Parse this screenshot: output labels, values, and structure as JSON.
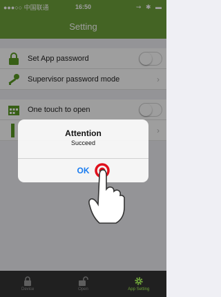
{
  "status_bar": {
    "carrier": "●●●○○ 中国联通",
    "time": "16:50",
    "right_icons": "⇝ ✱ ▬"
  },
  "nav": {
    "title": "Setting"
  },
  "rows": [
    {
      "label": "Set App password",
      "icon": "lock-icon",
      "accessory": "toggle"
    },
    {
      "label": "Supervisor password mode",
      "icon": "key-icon",
      "accessory": "chevron"
    },
    {
      "label": "One touch to open",
      "icon": "calendar-icon",
      "accessory": "toggle"
    },
    {
      "label": "",
      "icon": "tool-icon",
      "accessory": "chevron"
    }
  ],
  "alert": {
    "title": "Attention",
    "message": "Succeed",
    "ok_label": "OK"
  },
  "tabs": [
    {
      "label": "Device",
      "icon": "padlock-icon",
      "active": false
    },
    {
      "label": "Open",
      "icon": "unlock-icon",
      "active": false
    },
    {
      "label": "App Setting",
      "icon": "gear-icon",
      "active": true
    }
  ],
  "colors": {
    "accent": "#6ea23a",
    "ok_blue": "#1a7cf0",
    "tab_bg": "#202020",
    "icon_green": "#5a9a22"
  }
}
